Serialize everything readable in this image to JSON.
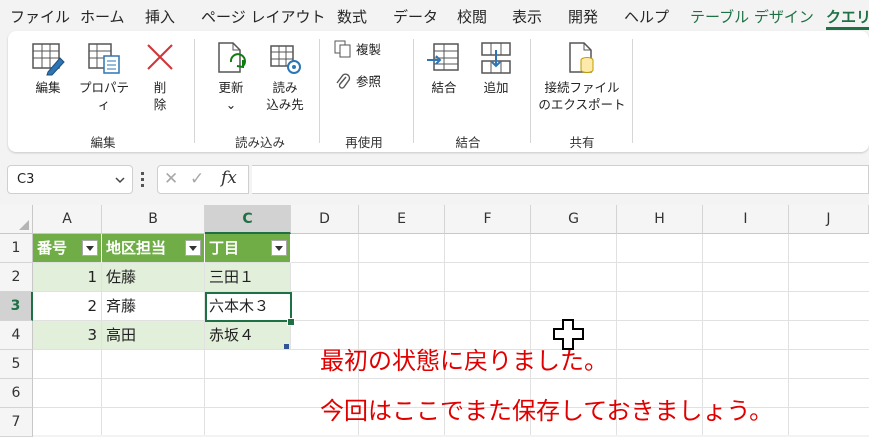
{
  "ribbon_tabs": [
    {
      "label": "ファイル"
    },
    {
      "label": "ホーム"
    },
    {
      "label": "挿入"
    },
    {
      "label": "ページ レイアウト"
    },
    {
      "label": "数式"
    },
    {
      "label": "データ"
    },
    {
      "label": "校閲"
    },
    {
      "label": "表示"
    },
    {
      "label": "開発"
    },
    {
      "label": "ヘルプ"
    },
    {
      "label": "テーブル デザイン"
    },
    {
      "label": "クエリ"
    }
  ],
  "active_tab": "クエリ",
  "ribbon": {
    "edit": {
      "edit_label": "編集",
      "properties_label": "プロパティ",
      "delete_line1": "削",
      "delete_line2": "除",
      "group": "編集"
    },
    "load": {
      "refresh_label": "更新",
      "refresh_caret": "⌄",
      "loadto_line1": "読み",
      "loadto_line2": "込み先",
      "group": "読み込み"
    },
    "reuse": {
      "duplicate_label": "複製",
      "reference_label": "参照",
      "group": "再使用"
    },
    "combine": {
      "merge_label": "結合",
      "append_label": "追加",
      "group": "結合"
    },
    "share": {
      "export_line1": "接続ファイル",
      "export_line2": "のエクスポート",
      "group": "共有"
    }
  },
  "formula_bar": {
    "name_box": "C3",
    "cancel": "✕",
    "enter": "✓",
    "fx": "fx",
    "formula": ""
  },
  "columns": [
    "A",
    "B",
    "C",
    "D",
    "E",
    "F",
    "G",
    "H",
    "I",
    "J"
  ],
  "rows": [
    "1",
    "2",
    "3",
    "4",
    "5",
    "6",
    "7"
  ],
  "selected_cell": "C3",
  "table": {
    "headers": [
      "番号",
      "地区担当",
      "丁目"
    ],
    "rows": [
      [
        "1",
        "佐藤",
        "三田１"
      ],
      [
        "2",
        "斉藤",
        "六本木３"
      ],
      [
        "3",
        "高田",
        "赤坂４"
      ]
    ]
  },
  "annotation": {
    "line1": "最初の状態に戻りました。",
    "line2": "今回はここでまた保存しておきましょう。"
  },
  "colors": {
    "accent": "#1e7145",
    "table_header": "#70ad47",
    "band": "#e2efda",
    "note": "#e00000"
  }
}
